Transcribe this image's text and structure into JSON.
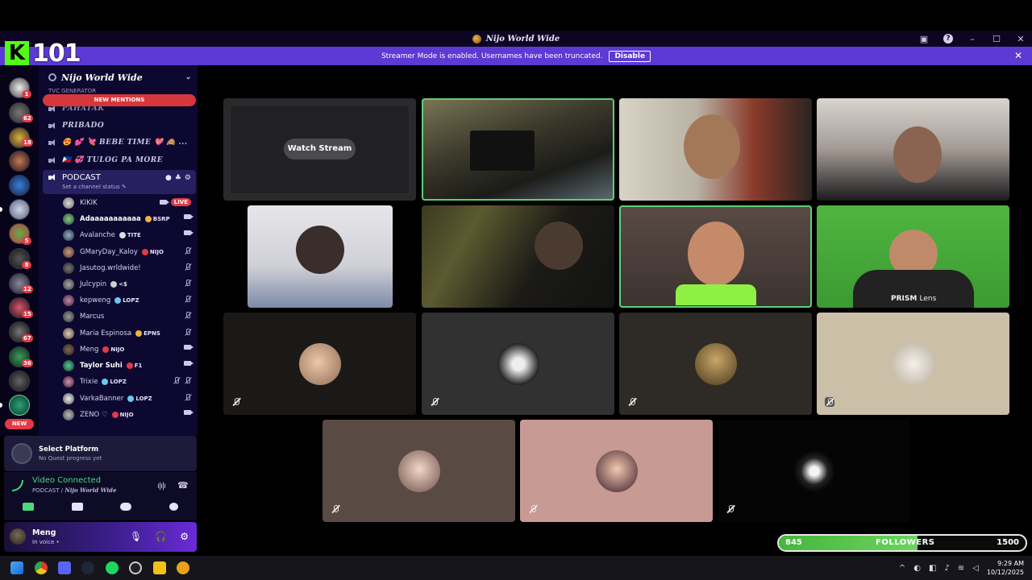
{
  "window": {
    "title": "Nijo World Wide"
  },
  "logo": {
    "letter": "K",
    "number": "101"
  },
  "banner": {
    "text": "Streamer Mode is enabled. Usernames have been truncated.",
    "disable_label": "Disable"
  },
  "rail": {
    "badges": [
      "1",
      "62",
      "18",
      "5",
      "8",
      "12",
      "15",
      "67",
      "36"
    ],
    "new_label": "NEW"
  },
  "server": {
    "name": "Nijo World Wide",
    "new_mentions": "NEW MENTIONS",
    "partial_channel": "TVC GENERATOR",
    "channels": [
      "PAHATAK",
      "PRIBADO",
      "😍 💕 💘 BEBE TIME 💖 🙈 ...",
      "🇵🇭 💞 TULOG PA MORE"
    ],
    "active_channel": {
      "name": "PODCAST",
      "status": "Set a channel status"
    }
  },
  "voice_users": [
    {
      "name": "KIKIK",
      "tag": "",
      "live": "LIVE"
    },
    {
      "name": "Adaaaaaaaaaaa",
      "tag": "BSRP",
      "live": ""
    },
    {
      "name": "Avalanche",
      "tag": "TITE",
      "live": ""
    },
    {
      "name": "GMaryDay_Kaloy",
      "tag": "NIJO",
      "live": ""
    },
    {
      "name": "Jasutog.wrldwide!",
      "tag": "",
      "live": ""
    },
    {
      "name": "Julcypin",
      "tag": "<$",
      "live": ""
    },
    {
      "name": "kepweng",
      "tag": "LOPZ",
      "live": ""
    },
    {
      "name": "Marcus",
      "tag": "",
      "live": ""
    },
    {
      "name": "Maria Espinosa",
      "tag": "EPNS",
      "live": ""
    },
    {
      "name": "Meng",
      "tag": "NIJO",
      "live": ""
    },
    {
      "name": "Taylor Suhi",
      "tag": "F1",
      "live": ""
    },
    {
      "name": "Trixie",
      "tag": "LOPZ",
      "live": ""
    },
    {
      "name": "VarkaBanner",
      "tag": "LOPZ",
      "live": ""
    },
    {
      "name": "ZENO ♡",
      "tag": "NIJO",
      "live": ""
    }
  ],
  "quest": {
    "title": "Select Platform",
    "subtitle": "No Quest progress yet"
  },
  "voice_panel": {
    "status": "Video Connected",
    "channel_prefix": "PODCAST / ",
    "server": "Nijo World Wide"
  },
  "user_panel": {
    "name": "Meng",
    "status": "In voice •"
  },
  "stage": {
    "watch_stream_label": "Watch Stream",
    "prism_label": "PRISM",
    "prism_suffix": "Lens"
  },
  "followers": {
    "current": "845",
    "label": "FOLLOWERS",
    "goal": "1500",
    "progress": 0.563
  },
  "clock": {
    "time": "9:29 AM",
    "date": "10/12/2025"
  }
}
